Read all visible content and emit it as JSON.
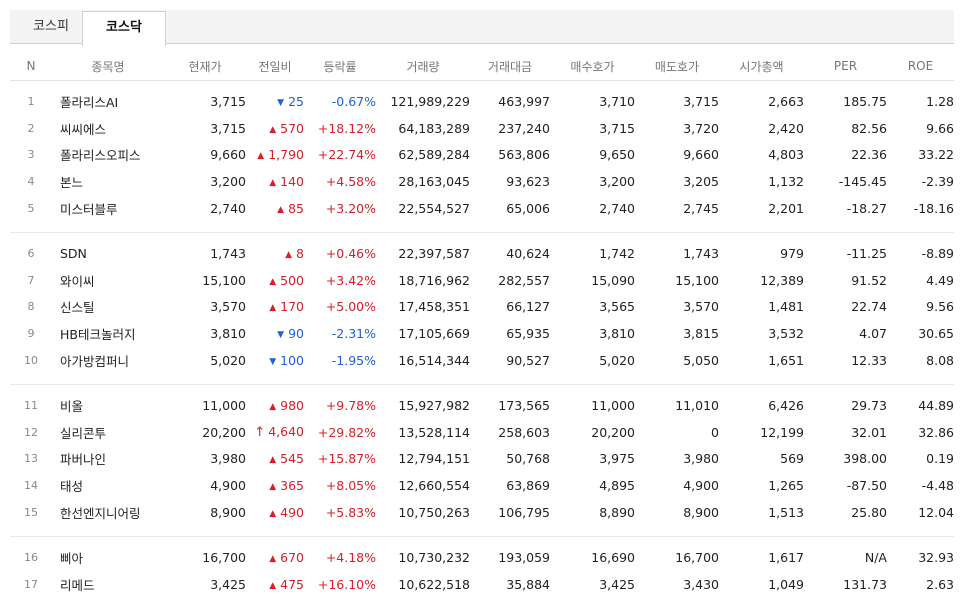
{
  "tabs": [
    {
      "label": "코스피",
      "active": false
    },
    {
      "label": "코스닥",
      "active": true
    }
  ],
  "columns": [
    "N",
    "종목명",
    "현재가",
    "전일비",
    "등락률",
    "거래량",
    "거래대금",
    "매수호가",
    "매도호가",
    "시가총액",
    "PER",
    "ROE"
  ],
  "colors": {
    "up": "#d6202a",
    "down": "#1d62d6"
  },
  "groups": [
    [
      {
        "n": "1",
        "name": "폴라리스AI",
        "price": "3,715",
        "dir": "down",
        "change": "25",
        "rate": "-0.67%",
        "volume": "121,989,229",
        "amount": "463,997",
        "bid": "3,710",
        "ask": "3,715",
        "mcap": "2,663",
        "per": "185.75",
        "roe": "1.28"
      },
      {
        "n": "2",
        "name": "씨씨에스",
        "price": "3,715",
        "dir": "up",
        "change": "570",
        "rate": "+18.12%",
        "volume": "64,183,289",
        "amount": "237,240",
        "bid": "3,715",
        "ask": "3,720",
        "mcap": "2,420",
        "per": "82.56",
        "roe": "9.66"
      },
      {
        "n": "3",
        "name": "폴라리스오피스",
        "price": "9,660",
        "dir": "up",
        "change": "1,790",
        "rate": "+22.74%",
        "volume": "62,589,284",
        "amount": "563,806",
        "bid": "9,650",
        "ask": "9,660",
        "mcap": "4,803",
        "per": "22.36",
        "roe": "33.22"
      },
      {
        "n": "4",
        "name": "본느",
        "price": "3,200",
        "dir": "up",
        "change": "140",
        "rate": "+4.58%",
        "volume": "28,163,045",
        "amount": "93,623",
        "bid": "3,200",
        "ask": "3,205",
        "mcap": "1,132",
        "per": "-145.45",
        "roe": "-2.39"
      },
      {
        "n": "5",
        "name": "미스터블루",
        "price": "2,740",
        "dir": "up",
        "change": "85",
        "rate": "+3.20%",
        "volume": "22,554,527",
        "amount": "65,006",
        "bid": "2,740",
        "ask": "2,745",
        "mcap": "2,201",
        "per": "-18.27",
        "roe": "-18.16"
      }
    ],
    [
      {
        "n": "6",
        "name": "SDN",
        "price": "1,743",
        "dir": "up",
        "change": "8",
        "rate": "+0.46%",
        "volume": "22,397,587",
        "amount": "40,624",
        "bid": "1,742",
        "ask": "1,743",
        "mcap": "979",
        "per": "-11.25",
        "roe": "-8.89"
      },
      {
        "n": "7",
        "name": "와이씨",
        "price": "15,100",
        "dir": "up",
        "change": "500",
        "rate": "+3.42%",
        "volume": "18,716,962",
        "amount": "282,557",
        "bid": "15,090",
        "ask": "15,100",
        "mcap": "12,389",
        "per": "91.52",
        "roe": "4.49"
      },
      {
        "n": "8",
        "name": "신스틸",
        "price": "3,570",
        "dir": "up",
        "change": "170",
        "rate": "+5.00%",
        "volume": "17,458,351",
        "amount": "66,127",
        "bid": "3,565",
        "ask": "3,570",
        "mcap": "1,481",
        "per": "22.74",
        "roe": "9.56"
      },
      {
        "n": "9",
        "name": "HB테크놀러지",
        "price": "3,810",
        "dir": "down",
        "change": "90",
        "rate": "-2.31%",
        "volume": "17,105,669",
        "amount": "65,935",
        "bid": "3,810",
        "ask": "3,815",
        "mcap": "3,532",
        "per": "4.07",
        "roe": "30.65"
      },
      {
        "n": "10",
        "name": "아가방컴퍼니",
        "price": "5,020",
        "dir": "down",
        "change": "100",
        "rate": "-1.95%",
        "volume": "16,514,344",
        "amount": "90,527",
        "bid": "5,020",
        "ask": "5,050",
        "mcap": "1,651",
        "per": "12.33",
        "roe": "8.08"
      }
    ],
    [
      {
        "n": "11",
        "name": "비올",
        "price": "11,000",
        "dir": "up",
        "change": "980",
        "rate": "+9.78%",
        "volume": "15,927,982",
        "amount": "173,565",
        "bid": "11,000",
        "ask": "11,010",
        "mcap": "6,426",
        "per": "29.73",
        "roe": "44.89"
      },
      {
        "n": "12",
        "name": "실리콘투",
        "price": "20,200",
        "dir": "limit",
        "change": "4,640",
        "rate": "+29.82%",
        "volume": "13,528,114",
        "amount": "258,603",
        "bid": "20,200",
        "ask": "0",
        "mcap": "12,199",
        "per": "32.01",
        "roe": "32.86"
      },
      {
        "n": "13",
        "name": "파버나인",
        "price": "3,980",
        "dir": "up",
        "change": "545",
        "rate": "+15.87%",
        "volume": "12,794,151",
        "amount": "50,768",
        "bid": "3,975",
        "ask": "3,980",
        "mcap": "569",
        "per": "398.00",
        "roe": "0.19"
      },
      {
        "n": "14",
        "name": "태성",
        "price": "4,900",
        "dir": "up",
        "change": "365",
        "rate": "+8.05%",
        "volume": "12,660,554",
        "amount": "63,869",
        "bid": "4,895",
        "ask": "4,900",
        "mcap": "1,265",
        "per": "-87.50",
        "roe": "-4.48"
      },
      {
        "n": "15",
        "name": "한선엔지니어링",
        "price": "8,900",
        "dir": "up",
        "change": "490",
        "rate": "+5.83%",
        "volume": "10,750,263",
        "amount": "106,795",
        "bid": "8,890",
        "ask": "8,900",
        "mcap": "1,513",
        "per": "25.80",
        "roe": "12.04"
      }
    ],
    [
      {
        "n": "16",
        "name": "삐아",
        "price": "16,700",
        "dir": "up",
        "change": "670",
        "rate": "+4.18%",
        "volume": "10,730,232",
        "amount": "193,059",
        "bid": "16,690",
        "ask": "16,700",
        "mcap": "1,617",
        "per": "N/A",
        "roe": "32.93"
      },
      {
        "n": "17",
        "name": "리메드",
        "price": "3,425",
        "dir": "up",
        "change": "475",
        "rate": "+16.10%",
        "volume": "10,622,518",
        "amount": "35,884",
        "bid": "3,425",
        "ask": "3,430",
        "mcap": "1,049",
        "per": "131.73",
        "roe": "2.63"
      }
    ]
  ]
}
